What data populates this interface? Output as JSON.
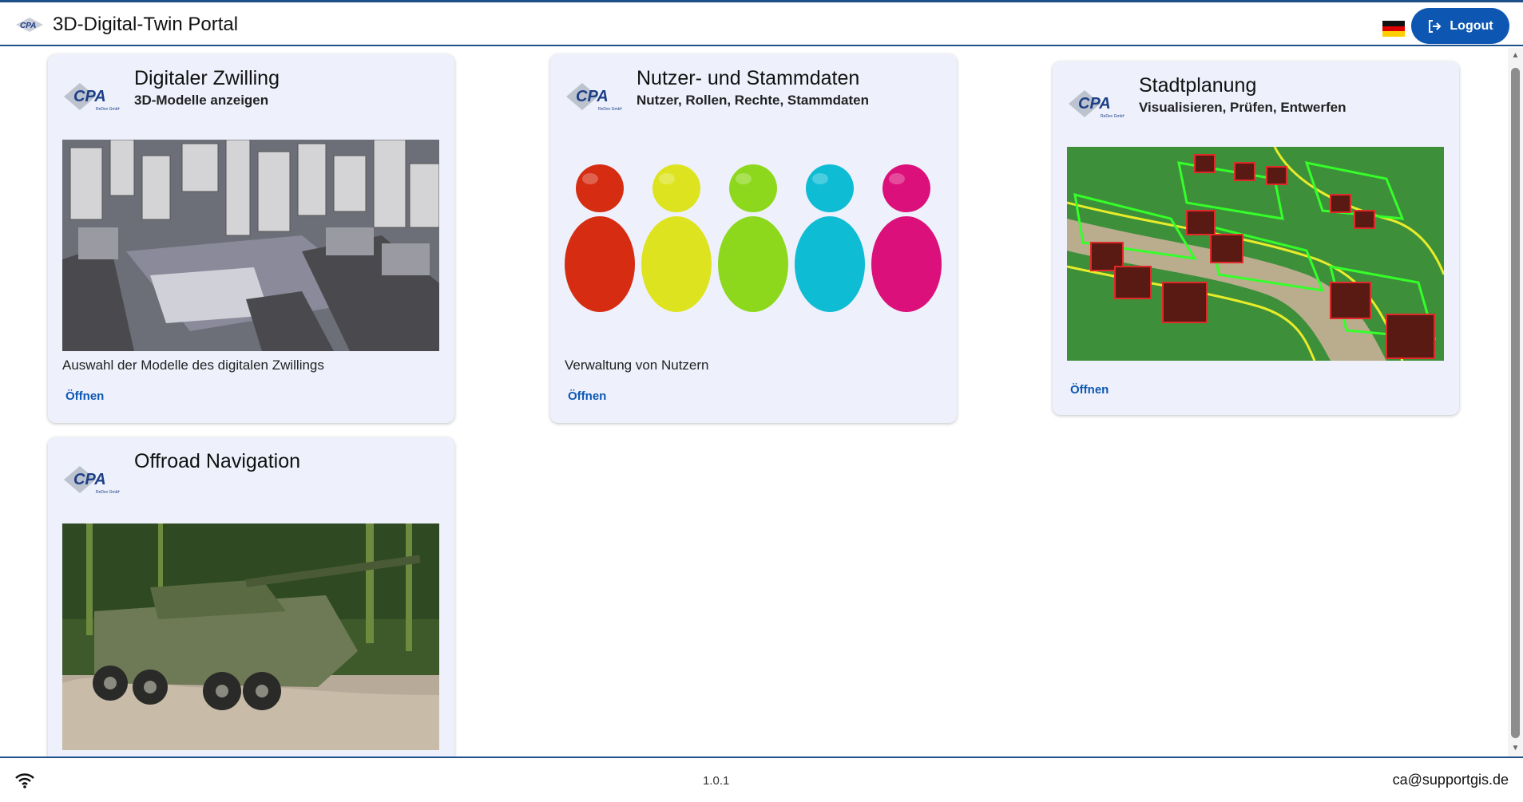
{
  "header": {
    "title": "3D-Digital-Twin Portal",
    "logo_text": "CPA",
    "logout_label": "Logout",
    "language_icon": "german-flag-icon"
  },
  "cards": [
    {
      "title": "Digitaler Zwilling",
      "subtitle": "3D-Modelle anzeigen",
      "description": "Auswahl der Modelle des digitalen Zwillings",
      "open_label": "Öffnen",
      "logo_text": "CPA",
      "image": "3d-city-model-image"
    },
    {
      "title": "Nutzer- und Stammdaten",
      "subtitle": "Nutzer, Rollen, Rechte, Stammdaten",
      "description": "Verwaltung von Nutzern",
      "open_label": "Öffnen",
      "logo_text": "CPA",
      "image": "colored-people-figures-image"
    },
    {
      "title": "Stadtplanung",
      "subtitle": "Visualisieren, Prüfen, Entwerfen",
      "description": "",
      "open_label": "Öffnen",
      "logo_text": "CPA",
      "image": "urban-planning-map-image"
    },
    {
      "title": "Offroad Navigation",
      "subtitle": "",
      "description": "",
      "open_label": "",
      "logo_text": "CPA",
      "image": "military-vehicle-image"
    }
  ],
  "footer": {
    "version": "1.0.1",
    "email": "ca@supportgis.de",
    "connection_icon": "wifi-icon"
  },
  "colors": {
    "primary": "#0d57b3",
    "header_border": "#1f4f8a",
    "card_background": "#eef1fc"
  }
}
